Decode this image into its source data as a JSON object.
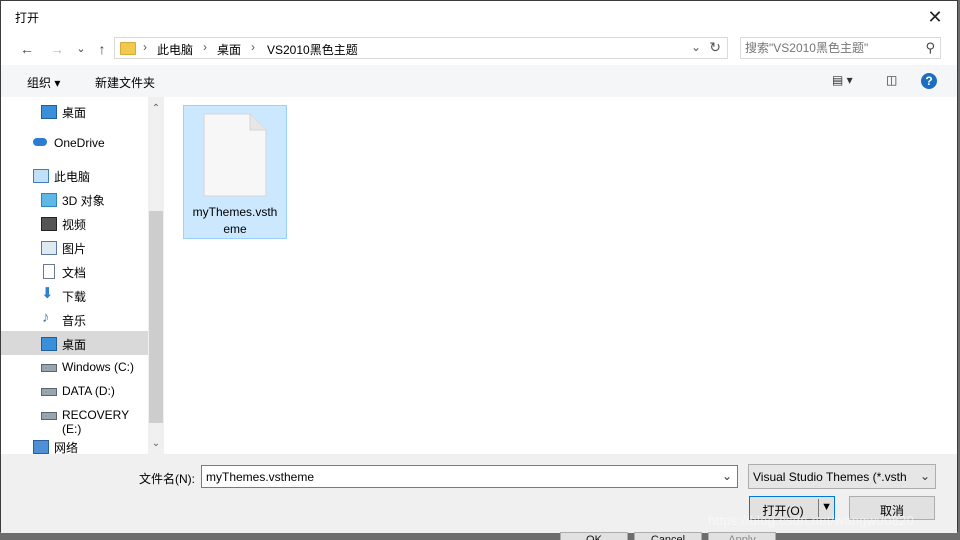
{
  "window": {
    "title": "打开"
  },
  "nav": {
    "back": "←",
    "forward": "→",
    "recent": "⌄",
    "up": "↑"
  },
  "address": {
    "crumbs": [
      "此电脑",
      "桌面",
      "VS2010黑色主题"
    ],
    "separator": "›"
  },
  "search": {
    "placeholder": "搜索\"VS2010黑色主题\""
  },
  "toolbar": {
    "organize": "组织 ▾",
    "new_folder": "新建文件夹",
    "help": "?"
  },
  "sidebar": {
    "items": [
      {
        "label": "桌面",
        "icon": "desktop-icon"
      },
      {
        "label": "OneDrive",
        "icon": "cloud-icon"
      },
      {
        "label": "此电脑",
        "icon": "computer-icon"
      },
      {
        "label": "3D 对象",
        "icon": "cube-icon"
      },
      {
        "label": "视频",
        "icon": "video-icon"
      },
      {
        "label": "图片",
        "icon": "picture-icon"
      },
      {
        "label": "文档",
        "icon": "document-icon"
      },
      {
        "label": "下载",
        "icon": "download-icon"
      },
      {
        "label": "音乐",
        "icon": "music-icon"
      },
      {
        "label": "桌面",
        "icon": "desktop-icon",
        "selected": true
      },
      {
        "label": "Windows (C:)",
        "icon": "windows-drive-icon"
      },
      {
        "label": "DATA (D:)",
        "icon": "drive-icon"
      },
      {
        "label": "RECOVERY (E:)",
        "icon": "drive-icon"
      },
      {
        "label": "网络",
        "icon": "network-icon"
      }
    ]
  },
  "files": [
    {
      "name": "myThemes.vstheme",
      "name_line1": "myThemes.vsth",
      "name_line2": "eme",
      "selected": true
    }
  ],
  "footer": {
    "filename_label": "文件名(N):",
    "filename_value": "myThemes.vstheme",
    "filetype_value": "Visual Studio Themes (*.vsth",
    "open_label": "打开(O)",
    "cancel_label": "取消"
  },
  "background": {
    "ok": "OK",
    "cancel": "Cancel",
    "apply": "Apply"
  },
  "watermark": "https://blog.csdn.net/wangwu0820",
  "colors": {
    "selection": "#cce8ff",
    "selection_border": "#99d1ff",
    "accent": "#0078d7",
    "help": "#1b6ec2"
  }
}
